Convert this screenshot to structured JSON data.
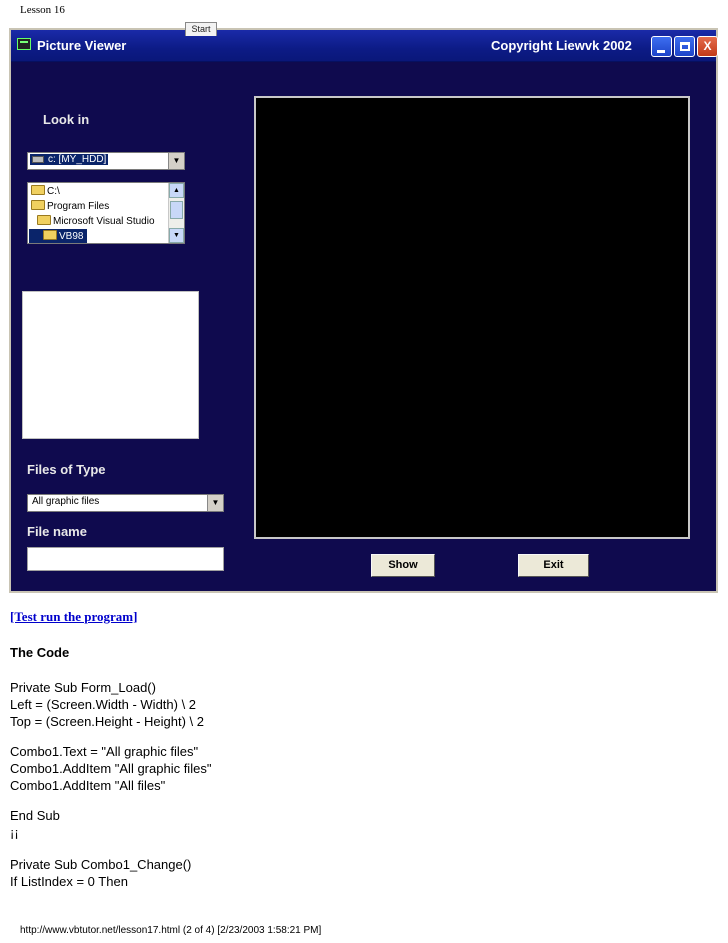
{
  "page_header": "Lesson 16",
  "window": {
    "title": "Picture Viewer",
    "copyright": "Copyright Liewvk  2002",
    "start_tab": "Start",
    "controls": {
      "minimize": "",
      "maximize": "",
      "close": "X"
    }
  },
  "form": {
    "look_in_label": "Look in",
    "drive_combo_value": "c: [MY_HDD]",
    "dir_items": [
      "C:\\",
      "Program Files",
      "Microsoft Visual Studio",
      "VB98"
    ],
    "files_of_type_label": "Files of Type",
    "type_combo_value": "All graphic files",
    "file_name_label": "File name",
    "file_name_value": "",
    "show_button": "Show",
    "exit_button": "Exit"
  },
  "article": {
    "link_text": "[Test run the program]",
    "heading": "The Code",
    "code_lines": [
      "Private Sub Form_Load()",
      "Left = (Screen.Width - Width) \\ 2",
      "Top = (Screen.Height - Height) \\ 2",
      "",
      "Combo1.Text = \"All graphic files\"",
      "Combo1.AddItem \"All graphic files\"",
      "Combo1.AddItem \"All files\"",
      "",
      "End Sub",
      "¡¡",
      "",
      "Private Sub Combo1_Change()",
      "If ListIndex = 0 Then"
    ]
  },
  "footer": "http://www.vbtutor.net/lesson17.html (2 of 4) [2/23/2003 1:58:21 PM]"
}
